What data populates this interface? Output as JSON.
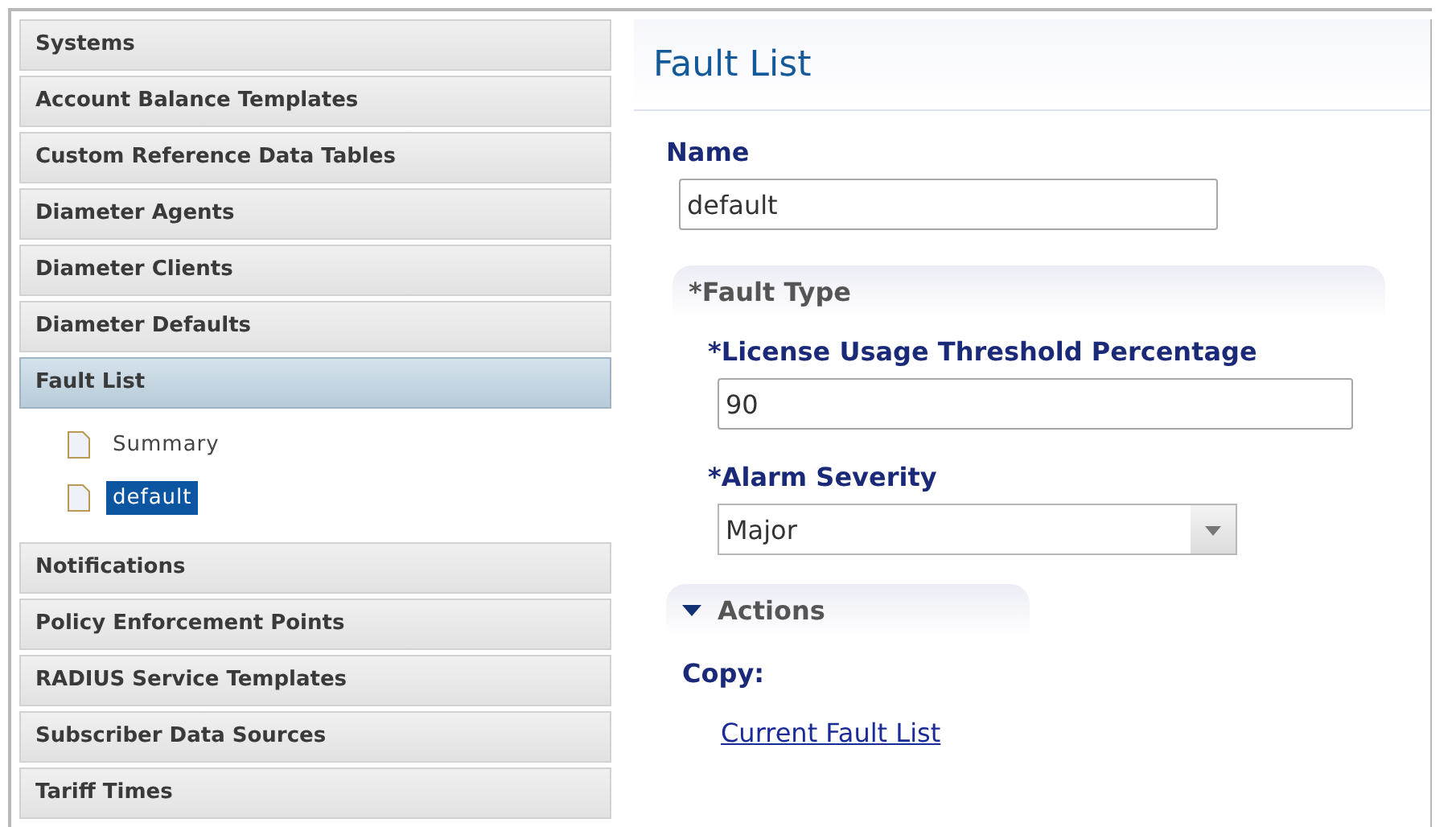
{
  "sidebar": {
    "items": [
      {
        "label": "Systems",
        "selected": false
      },
      {
        "label": "Account Balance Templates",
        "selected": false
      },
      {
        "label": "Custom Reference Data Tables",
        "selected": false
      },
      {
        "label": "Diameter Agents",
        "selected": false
      },
      {
        "label": "Diameter Clients",
        "selected": false
      },
      {
        "label": "Diameter Defaults",
        "selected": false
      },
      {
        "label": "Fault List",
        "selected": true,
        "children": [
          {
            "label": "Summary",
            "selected": false
          },
          {
            "label": "default",
            "selected": true
          }
        ]
      },
      {
        "label": "Notifications",
        "selected": false
      },
      {
        "label": "Policy Enforcement Points",
        "selected": false
      },
      {
        "label": "RADIUS Service Templates",
        "selected": false
      },
      {
        "label": "Subscriber Data Sources",
        "selected": false
      },
      {
        "label": "Tariff Times",
        "selected": false
      }
    ]
  },
  "panel": {
    "title": "Fault List",
    "name": {
      "label": "Name",
      "value": "default"
    },
    "fault_type": {
      "title": "*Fault Type",
      "fields": [
        {
          "kind": "text",
          "label": "*License Usage Threshold Percentage",
          "value": "90"
        },
        {
          "kind": "select",
          "label": "*Alarm Severity",
          "value": "Major"
        }
      ]
    },
    "actions": {
      "title": "Actions",
      "expanded": true,
      "copy_label": "Copy:",
      "links": [
        "Current Fault List"
      ]
    }
  }
}
